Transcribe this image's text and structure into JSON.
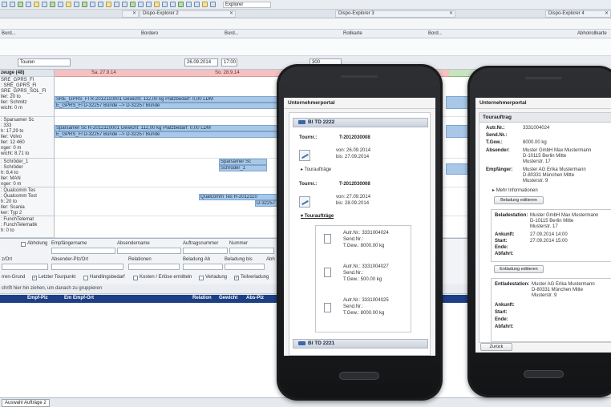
{
  "toolbar": {
    "search_value": "Explorer"
  },
  "panels": [
    {
      "label": "Dispo-Explorer 2"
    },
    {
      "label": "Dispo-Explorer 3"
    },
    {
      "label": "Dispo-Explorer 4"
    }
  ],
  "columns": [
    "Bord...",
    "Bordero",
    "Bord...",
    "Rollkarte",
    "Bord...",
    "Abholrollkarte"
  ],
  "dispo": {
    "view_select": "Touren",
    "date": "26.09.2014",
    "time": "17:00",
    "zoom": "300",
    "vehicles_header": "zeuge (48)",
    "days": [
      "Sa. 27.9.14",
      "So. 28.9.14"
    ]
  },
  "vehicles": [
    {
      "lines": [
        "SRE_GPRS_Fl",
        ": SRE_GPRS_Fl",
        "SRE_GPRS_SOL_Fl",
        "ller: 20 to",
        "ller: Schmitz",
        "wicht: 0 m"
      ]
    },
    {
      "lines": [
        ": Sparsamer Sc",
        ": 333",
        "h: 17,29 to",
        "ller: Volvo",
        "ller: 12 460",
        "nger: 0 m",
        "wicht: 8,71 to"
      ]
    },
    {
      "lines": [
        ": Schröder_1",
        ": Schröder",
        "h: 8,4 to",
        "ller: MAN",
        "nger: 0 m"
      ]
    },
    {
      "lines": [
        ": Qualcomm Tes",
        ": Qualcomm Test",
        "h: 20 to",
        "ller: Scania",
        "ker: Typ 2"
      ]
    },
    {
      "lines": [
        ": FunchTelemat",
        ": FunchTelematik",
        "h: 0 to"
      ]
    }
  ],
  "gantt_rows": [
    {
      "bars": [
        {
          "text": "SRE_GPRS_Fl  R-2012110001  Gewicht: 112,00 kg Platzbedarf: 0,00 LDM"
        },
        {
          "text": "E_GPRS_Fl  D-32257 Bünde --> D-32257 Bünde"
        }
      ]
    },
    {
      "bars": [
        {
          "text": "Sparsamer Sc  R-2012110001  Gewicht: 112,00 kg Platzbedarf: 0,00 LDM"
        },
        {
          "text": "E_GPRS_Fl  D-32257 Bünde --> D-32257 Bünde"
        }
      ]
    },
    {
      "bars": [
        {
          "text": "Sparsamer Sc"
        },
        {
          "text": "Schröder_1"
        }
      ]
    },
    {
      "bars": [
        {
          "text": "Sparsamer Sc"
        },
        {
          "text": "Schröder_1"
        }
      ]
    },
    {
      "bars": [
        {
          "text": "Qualcomm Tes   R-2012110"
        },
        {
          "text": "D-32257 Bü"
        }
      ]
    }
  ],
  "filter": {
    "abholung": "Abholung",
    "empfaengername": "Empfängername",
    "absendername": "Absendername",
    "auftragsnummer": "Auftragsnummer",
    "nummer": "Nummer",
    "plz_ort": "z/Ort",
    "absender_plz_ort": "Absender-Plz/Ort",
    "relationen": "Relationen",
    "beladung_ab": "Beladung Ab",
    "beladung_bis": "Beladung bis",
    "abh": "Abh",
    "checks": [
      "rren-Grund",
      "Letzter Tourpunkt",
      "Handlingsbedarf",
      "Kosten / Erlöse ermitteln",
      "Verladung",
      "Teilverladung"
    ]
  },
  "group_hint": "chrift hier hin ziehen, um danach zu gruppieren",
  "table_headers": [
    "Empf-Plz",
    "Em Empf-Ort",
    "Relation",
    "Gewicht",
    "Abs-Plz"
  ],
  "status": {
    "tab": "Auswahl Aufträge 2"
  },
  "phone1": {
    "app_title": "Unternehmerportal",
    "tour1_title": "BI TD 2222",
    "tour_label": "Tournr.:",
    "tour1_nr": "T-2012030008",
    "tour1_von": "von: 26.09.2014",
    "tour1_bis": "bis:  27.09.2014",
    "toggle_label": "Touraufträge",
    "tour2_nr": "T-2012030008",
    "tour2_von": "von: 27.09.2014",
    "tour2_bis": "bis:  28.09.2014",
    "orders_label": "Touraufträge",
    "orders": [
      {
        "autr": "Autr.Nr.:  3331004024",
        "send": "Send.Nr.:",
        "tgew": "T.Gew.:     8000.00 kg"
      },
      {
        "autr": "Autr.Nr.:  3331004027",
        "send": "Send.Nr.:",
        "tgew": "T.Gew.:     500.00 kg"
      },
      {
        "autr": "Autr.Nr.:  3331004025",
        "send": "Send.Nr.:",
        "tgew": "T.Gew.:     8000.00 kg"
      }
    ],
    "tour3_title": "BI TD 2221"
  },
  "phone2": {
    "app_title": "Unternehmerportal",
    "section": "Tourauftrag",
    "autr_label": "Autr.Nr.:",
    "autr_value": "3331004024",
    "send_label": "Send.Nr.:",
    "tgew_label": "T.Gew.:",
    "tgew_value": "8000.00 kg",
    "absender_label": "Absender:",
    "absender_lines": [
      "Muster GmbH Max Mustermann",
      "D-10115 Berlin Mitte",
      "Musterstr. 17"
    ],
    "empfaenger_label": "Empfänger:",
    "empfaenger_lines": [
      "Muster AG Erika Mustermann",
      "D-80331 München Mitte",
      "Musterstr. 9"
    ],
    "more_info": "Mehr Informationen",
    "edit_loading": "Beladung editieren",
    "beladestation_label": "Beladestation:",
    "beladestation_lines": [
      "Muster GmbH Max Mustermann",
      "D-10115 Berlin Mitte",
      "Musterstr. 17"
    ],
    "ankunft_label": "Ankunft:",
    "ankunft_value": "27.09.2014 14:00",
    "start_label": "Start:",
    "start_value": "27.09.2014 15:00",
    "ende_label": "Ende:",
    "abfahrt_label": "Abfahrt:",
    "edit_unloading": "Entladung editieren",
    "entladestation_label": "Entladestation:",
    "entladestation_lines": [
      "Muster AG Erika Mustermann",
      "D-80331 München Mitte",
      "Musterstr. 9"
    ],
    "back": "Zurück"
  }
}
